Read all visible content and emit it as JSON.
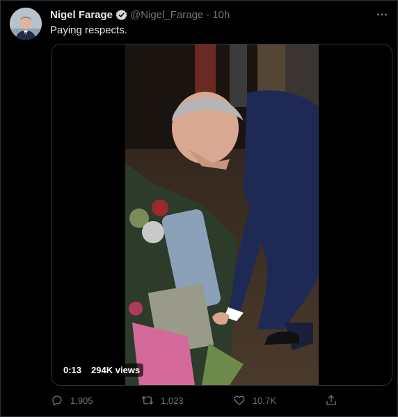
{
  "tweet": {
    "author_name": "Nigel Farage",
    "handle": "@Nigel_Farage",
    "separator": "·",
    "time": "10h",
    "text": "Paying respects.",
    "verified": true
  },
  "video": {
    "duration": "0:13",
    "views": "294K views"
  },
  "actions": {
    "replies": "1,905",
    "retweets": "1,023",
    "likes": "10.7K"
  },
  "icons": {
    "more": "more-horizontal-icon",
    "reply": "reply-icon",
    "retweet": "retweet-icon",
    "like": "heart-icon",
    "share": "share-icon",
    "verified": "verified-badge-icon"
  },
  "colors": {
    "background": "#000000",
    "text_primary": "#e7e9ea",
    "text_secondary": "#71767b",
    "border": "#2f3336",
    "verified_badge": "#d9d9d9"
  }
}
